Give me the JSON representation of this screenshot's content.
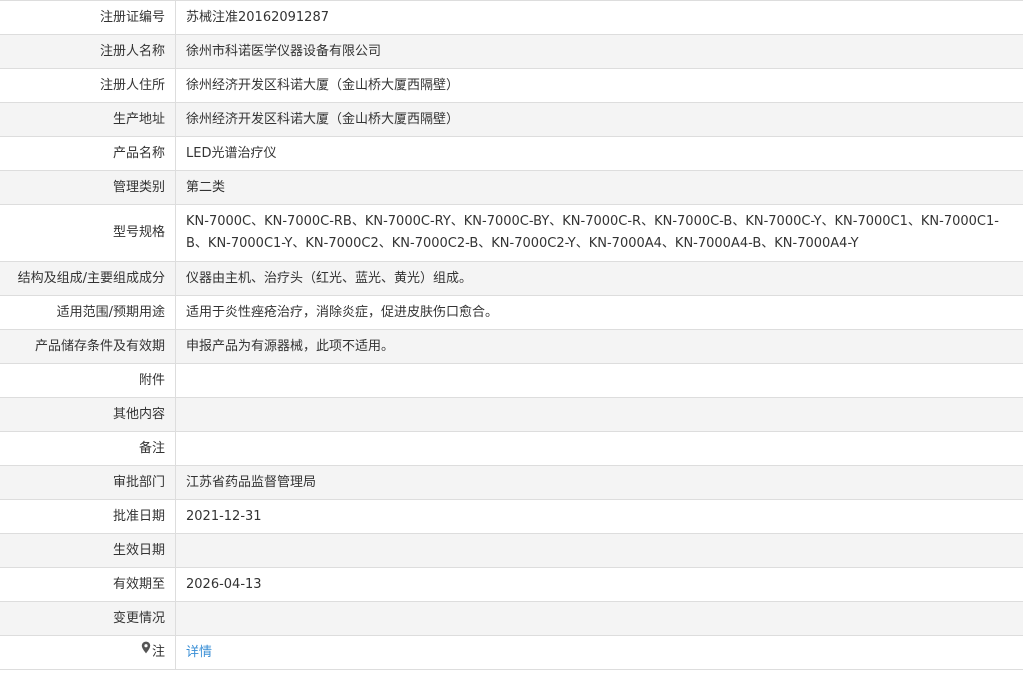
{
  "rows": [
    {
      "label": "注册证编号",
      "value": "苏械注准20162091287"
    },
    {
      "label": "注册人名称",
      "value": "徐州市科诺医学仪器设备有限公司"
    },
    {
      "label": "注册人住所",
      "value": "徐州经济开发区科诺大厦（金山桥大厦西隔壁）"
    },
    {
      "label": "生产地址",
      "value": "徐州经济开发区科诺大厦（金山桥大厦西隔壁）"
    },
    {
      "label": "产品名称",
      "value": "LED光谱治疗仪"
    },
    {
      "label": "管理类别",
      "value": "第二类"
    },
    {
      "label": "型号规格",
      "value": "KN-7000C、KN-7000C-RB、KN-7000C-RY、KN-7000C-BY、KN-7000C-R、KN-7000C-B、KN-7000C-Y、KN-7000C1、KN-7000C1-B、KN-7000C1-Y、KN-7000C2、KN-7000C2-B、KN-7000C2-Y、KN-7000A4、KN-7000A4-B、KN-7000A4-Y"
    },
    {
      "label": "结构及组成/主要组成成分",
      "value": "仪器由主机、治疗头（红光、蓝光、黄光）组成。"
    },
    {
      "label": "适用范围/预期用途",
      "value": "适用于炎性痤疮治疗，消除炎症，促进皮肤伤口愈合。"
    },
    {
      "label": "产品储存条件及有效期",
      "value": "申报产品为有源器械，此项不适用。"
    },
    {
      "label": "附件",
      "value": ""
    },
    {
      "label": "其他内容",
      "value": ""
    },
    {
      "label": "备注",
      "value": ""
    },
    {
      "label": "审批部门",
      "value": "江苏省药品监督管理局"
    },
    {
      "label": "批准日期",
      "value": "2021-12-31"
    },
    {
      "label": "生效日期",
      "value": ""
    },
    {
      "label": "有效期至",
      "value": "2026-04-13"
    },
    {
      "label": "变更情况",
      "value": ""
    }
  ],
  "note_row": {
    "label": "注",
    "icon": "location-pin-icon",
    "link_text": "详情"
  },
  "colors": {
    "border": "#dddddd",
    "stripe": "#f4f4f4",
    "link": "#3a8fd6",
    "text": "#333333"
  }
}
